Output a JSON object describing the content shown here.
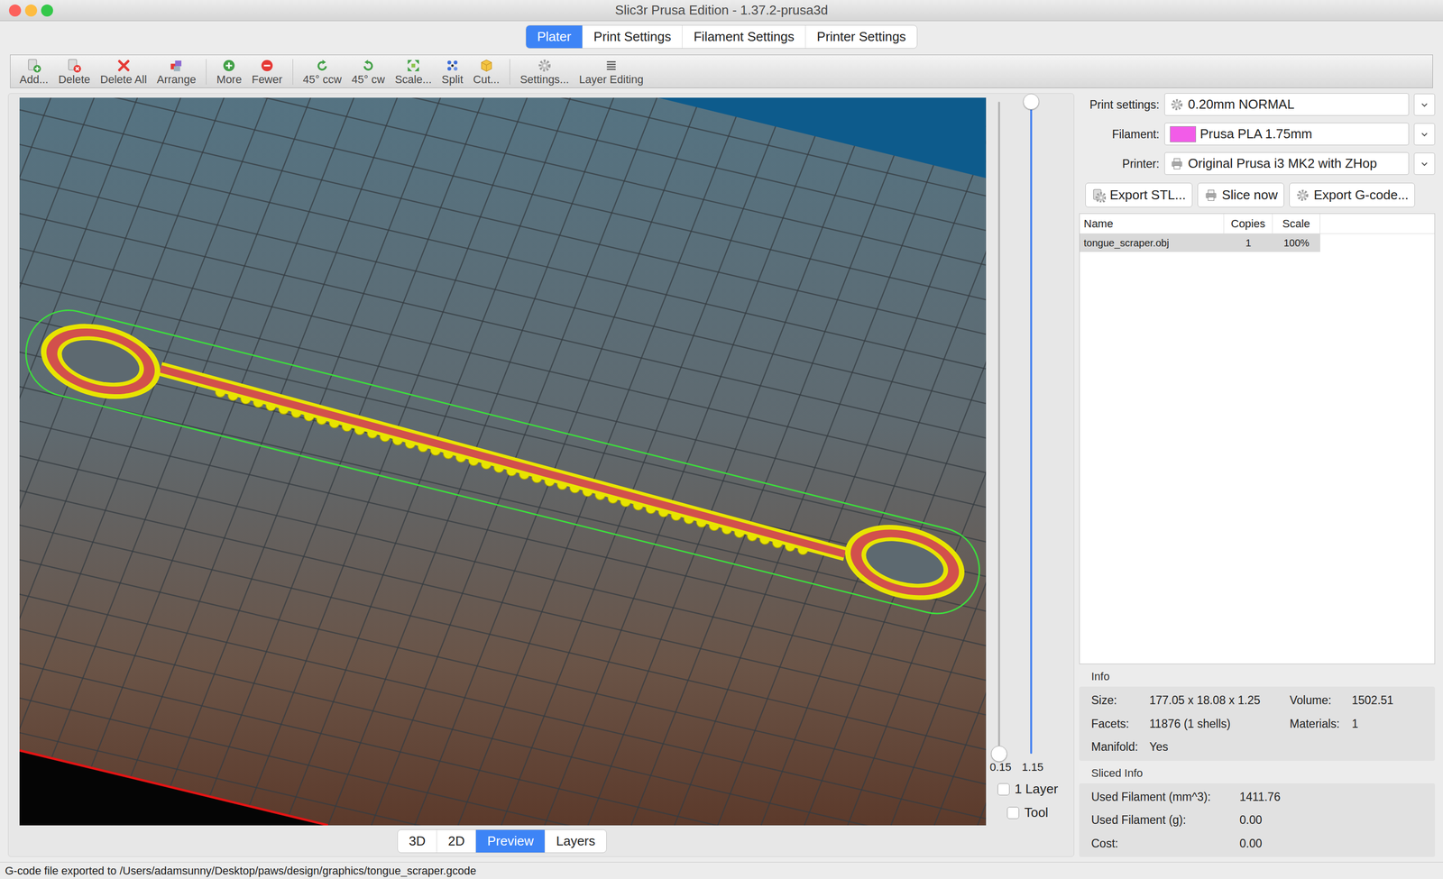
{
  "window": {
    "title": "Slic3r Prusa Edition - 1.37.2-prusa3d"
  },
  "tabs": [
    {
      "label": "Plater",
      "selected": true
    },
    {
      "label": "Print Settings",
      "selected": false
    },
    {
      "label": "Filament Settings",
      "selected": false
    },
    {
      "label": "Printer Settings",
      "selected": false
    }
  ],
  "toolbar": [
    [
      {
        "label": "Add..."
      },
      {
        "label": "Delete"
      },
      {
        "label": "Delete All"
      },
      {
        "label": "Arrange"
      }
    ],
    [
      {
        "label": "More"
      },
      {
        "label": "Fewer"
      }
    ],
    [
      {
        "label": "45° ccw"
      },
      {
        "label": "45° cw"
      },
      {
        "label": "Scale..."
      },
      {
        "label": "Split"
      },
      {
        "label": "Cut..."
      }
    ],
    [
      {
        "label": "Settings..."
      },
      {
        "label": "Layer Editing"
      }
    ]
  ],
  "layer_sliders": [
    {
      "reading": "0.15",
      "level": 0
    },
    {
      "reading": "1.15",
      "level": 1
    }
  ],
  "layer_options": [
    {
      "label": "1 Layer",
      "checked": false
    },
    {
      "label": "Tool",
      "checked": false
    }
  ],
  "view_buttons": [
    {
      "label": "3D",
      "selected": false
    },
    {
      "label": "2D",
      "selected": false
    },
    {
      "label": "Preview",
      "selected": true
    },
    {
      "label": "Layers",
      "selected": false
    }
  ],
  "settings": [
    {
      "label": "Print settings:",
      "value": "0.20mm NORMAL",
      "kind": "print"
    },
    {
      "label": "Filament:",
      "value": "Prusa PLA 1.75mm",
      "kind": "filament",
      "color": "#f25ce8"
    },
    {
      "label": "Printer:",
      "value": "Original Prusa i3 MK2 with ZHop",
      "kind": "printer"
    }
  ],
  "actions": [
    "Export STL...",
    "Slice now",
    "Export G-code..."
  ],
  "objects": {
    "columns": [
      "Name",
      "Copies",
      "Scale"
    ],
    "rows": [
      {
        "cells": [
          "tongue_scraper.obj",
          "1",
          "100%"
        ],
        "selected": true
      }
    ]
  },
  "info": {
    "title": "Info",
    "fields": [
      {
        "label": "Size:",
        "value": "177.05 x 18.08 x 1.25"
      },
      {
        "label": "Volume:",
        "value": "1502.51"
      },
      {
        "label": "Facets:",
        "value": "11876 (1 shells)"
      },
      {
        "label": "Materials:",
        "value": "1"
      },
      {
        "label": "Manifold:",
        "value": "Yes"
      }
    ]
  },
  "sliced_info": {
    "title": "Sliced Info",
    "fields": [
      {
        "label": "Used Filament (mm^3):",
        "value": "1411.76"
      },
      {
        "label": "Used Filament (g):",
        "value": "0.00"
      },
      {
        "label": "Cost:",
        "value": "0.00"
      }
    ]
  },
  "status_bar": "G-code file exported to /Users/adamsunny/Desktop/paws/design/graphics/tongue_scraper.gcode"
}
